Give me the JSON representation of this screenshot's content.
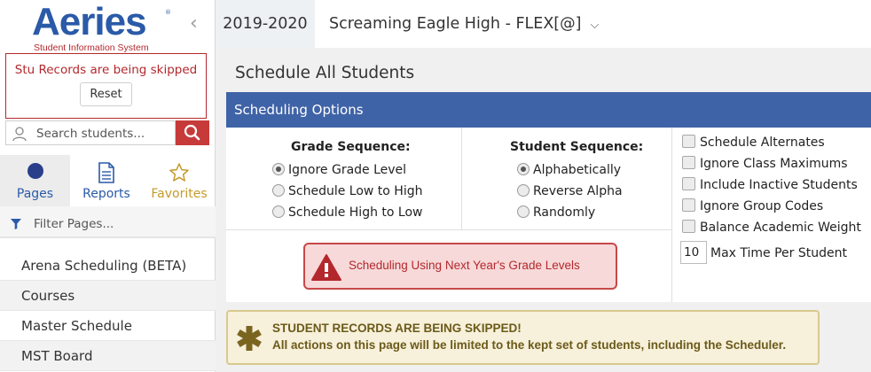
{
  "logo": {
    "brand": "Aeries",
    "tagline": "Student Information System",
    "reg": "®"
  },
  "sidebar": {
    "skip_message": "Stu Records are being skipped",
    "reset_label": "Reset",
    "search_placeholder": "Search students...",
    "tabs": [
      {
        "label": "Pages",
        "icon": "circle-icon"
      },
      {
        "label": "Reports",
        "icon": "document-icon"
      },
      {
        "label": "Favorites",
        "icon": "star-icon"
      }
    ],
    "filter_placeholder": "Filter Pages...",
    "menu_items": [
      "Arena Scheduling (BETA)",
      "Courses",
      "Master Schedule",
      "MST Board"
    ]
  },
  "topbar": {
    "year": "2019-2020",
    "school": "Screaming Eagle High - FLEX[@]"
  },
  "main": {
    "page_title": "Schedule All Students",
    "options_header": "Scheduling Options",
    "grade_sequence": {
      "label": "Grade Sequence:",
      "options": [
        "Ignore Grade Level",
        "Schedule Low to High",
        "Schedule High to Low"
      ],
      "selected": 0
    },
    "student_sequence": {
      "label": "Student Sequence:",
      "options": [
        "Alphabetically",
        "Reverse Alpha",
        "Randomly"
      ],
      "selected": 0
    },
    "checkboxes": [
      "Schedule Alternates",
      "Ignore Class Maximums",
      "Include Inactive Students",
      "Ignore Group Codes",
      "Balance Academic Weight"
    ],
    "max_time": {
      "value": "10",
      "label": "Max Time Per Student"
    },
    "grade_warning": "Scheduling Using Next Year's Grade Levels",
    "skip_banner": {
      "title": "STUDENT RECORDS ARE BEING SKIPPED!",
      "body": "All actions on this page will be limited to the kept set of students, including the Scheduler."
    }
  },
  "colors": {
    "brand_blue": "#2a5aa8",
    "header_blue": "#3f63a7",
    "alert_red": "#b3282d",
    "search_button": "#c73a3a",
    "warning_bg": "#f7f0da",
    "favorites_gold": "#c49a2a"
  }
}
